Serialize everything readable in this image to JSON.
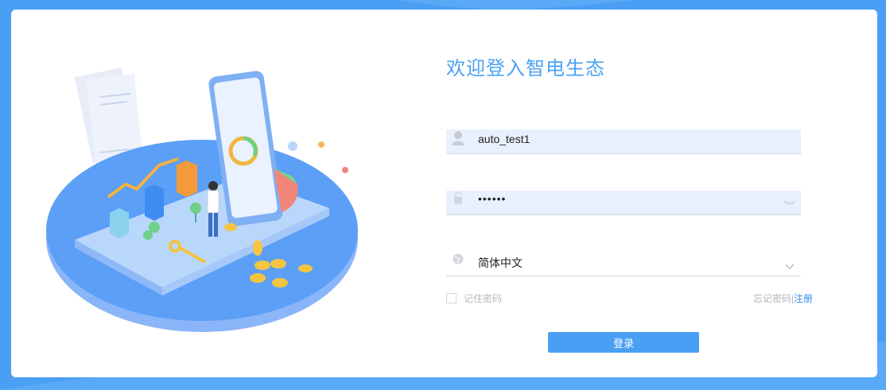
{
  "colors": {
    "background": "#4a9ff5",
    "accent": "#4ba2f4",
    "input_fill": "#e8f0fe",
    "button": "#4a9ff5"
  },
  "login": {
    "title": "欢迎登入智电生态",
    "username": {
      "value": "auto_test1",
      "icon": "user-icon"
    },
    "password": {
      "value": "••••••",
      "icon": "lock-icon",
      "toggle_icon": "eye-closed-icon"
    },
    "language": {
      "value": "简体中文",
      "icon": "globe-icon",
      "dropdown_icon": "chevron-down-icon"
    },
    "remember_label": "记住密码",
    "forgot_label": "忘记密码",
    "separator": "|",
    "register_label": "注册",
    "submit_label": "登录"
  }
}
